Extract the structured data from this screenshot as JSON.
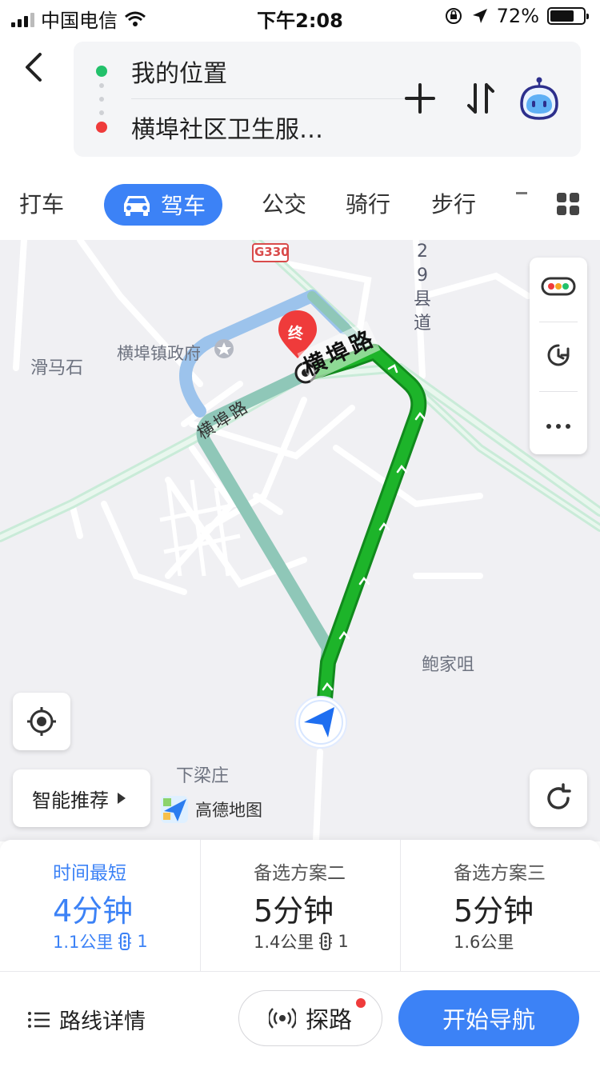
{
  "status_bar": {
    "carrier": "中国电信",
    "time": "下午2:08",
    "battery": "72%",
    "battery_level": 0.72
  },
  "header": {
    "origin": "我的位置",
    "destination": "横埠社区卫生服…"
  },
  "tabs": [
    {
      "label": "打车"
    },
    {
      "label": "驾车"
    },
    {
      "label": "公交"
    },
    {
      "label": "骑行"
    },
    {
      "label": "步行"
    }
  ],
  "map": {
    "road_g330": "G330",
    "county_road": "29县道",
    "road_name_main": "横埠路",
    "road_name_left": "横埠路",
    "poi_government": "横埠镇政府",
    "place_huamashi": "滑马石",
    "place_baojiaju": "鲍家咀",
    "place_xialiangzhuang": "下梁庄",
    "end_marker": "终",
    "logo_text": "高德地图"
  },
  "smart_recommend": "智能推荐",
  "routes": [
    {
      "title": "时间最短",
      "time": "4分钟",
      "distance": "1.1公里",
      "lights": "1"
    },
    {
      "title": "备选方案二",
      "time": "5分钟",
      "distance": "1.4公里",
      "lights": "1"
    },
    {
      "title": "备选方案三",
      "time": "5分钟",
      "distance": "1.6公里",
      "lights": ""
    }
  ],
  "actions": {
    "details": "路线详情",
    "explore": "探路",
    "start_nav": "开始导航"
  },
  "colors": {
    "accent": "#3c82f6",
    "route_main": "#1db42a",
    "route_alt1": "#8fc7b8",
    "route_alt2": "#9cc3ec",
    "end_marker": "#ef3b3b"
  }
}
